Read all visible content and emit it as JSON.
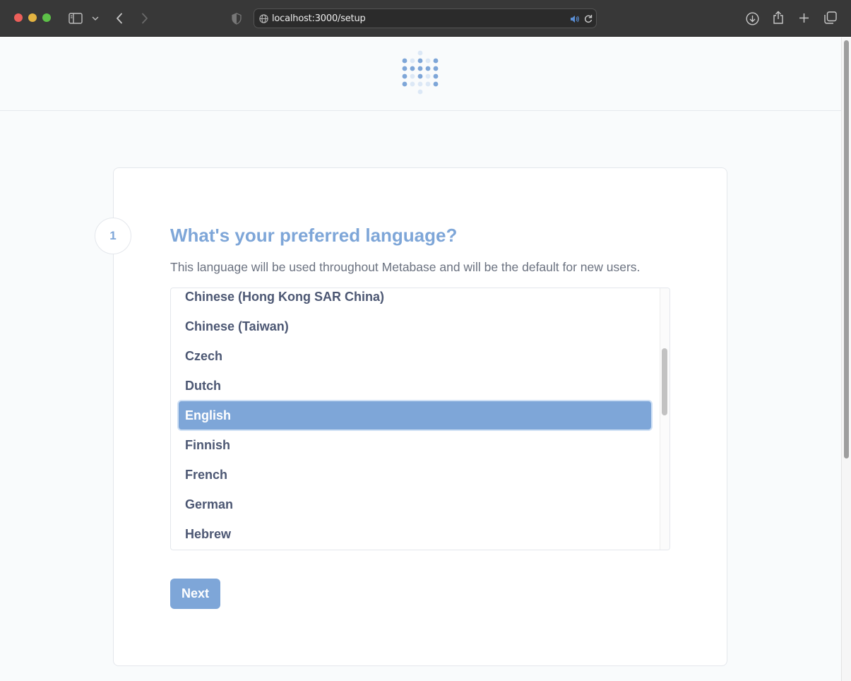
{
  "browser": {
    "url": "localhost:3000/setup"
  },
  "setup": {
    "step_number": "1",
    "title": "What's your preferred language?",
    "subtitle": "This language will be used throughout Metabase and will be the default for new users.",
    "languages": [
      "Chinese (Hong Kong SAR China)",
      "Chinese (Taiwan)",
      "Czech",
      "Dutch",
      "English",
      "Finnish",
      "French",
      "German",
      "Hebrew"
    ],
    "selected_language": "English",
    "next_label": "Next"
  },
  "colors": {
    "brand": "#7ea6d8",
    "text_dark": "#4c5773",
    "text_light": "#6b7280"
  }
}
